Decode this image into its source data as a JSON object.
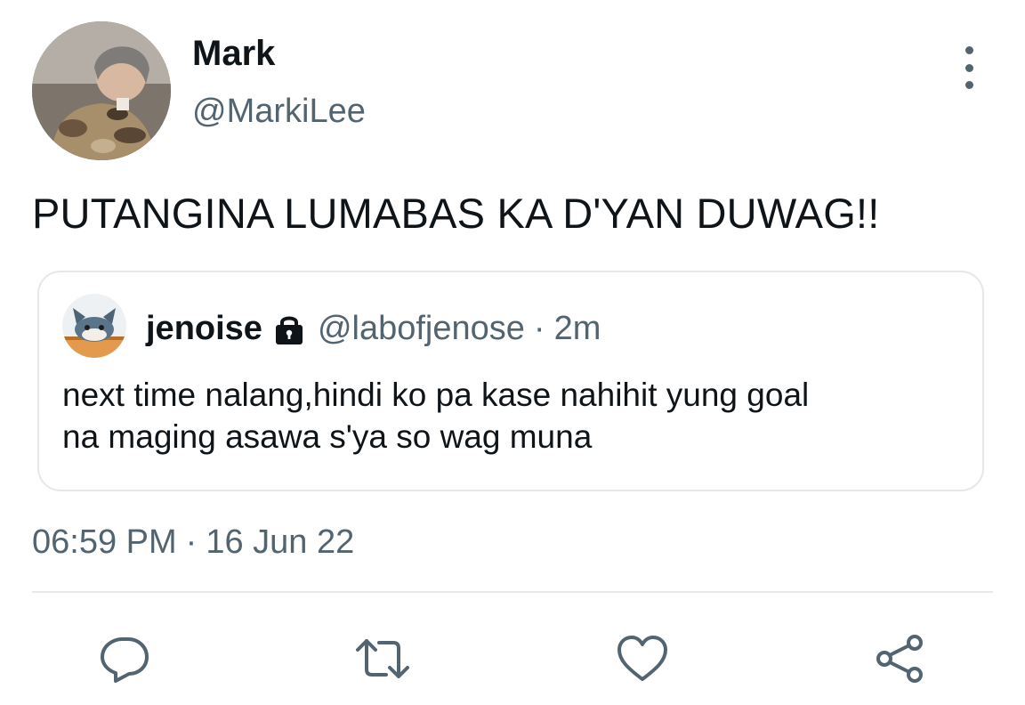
{
  "author": {
    "display_name": "Mark",
    "handle": "@MarkiLee",
    "avatar_icon": "profile-photo"
  },
  "tweet": {
    "text": "PUTANGINA LUMABAS KA D'YAN DUWAG!!",
    "time": "06:59 PM",
    "separator": "·",
    "date": "16 Jun 22"
  },
  "quoted_tweet": {
    "display_name": "jenoise",
    "protected_icon": "lock-icon",
    "handle": "@labofjenose",
    "separator": "·",
    "age": "2m",
    "text_line1": "next time nalang,hindi ko pa kase nahihit yung goal",
    "text_line2": "na maging asawa s'ya so wag muna"
  },
  "actions": {
    "reply_icon": "speech-bubble-icon",
    "retweet_icon": "retweet-icon",
    "like_icon": "heart-icon",
    "share_icon": "share-icon"
  },
  "colors": {
    "text_primary": "#0f1419",
    "text_secondary": "#536471",
    "border": "#e5e8eb"
  }
}
